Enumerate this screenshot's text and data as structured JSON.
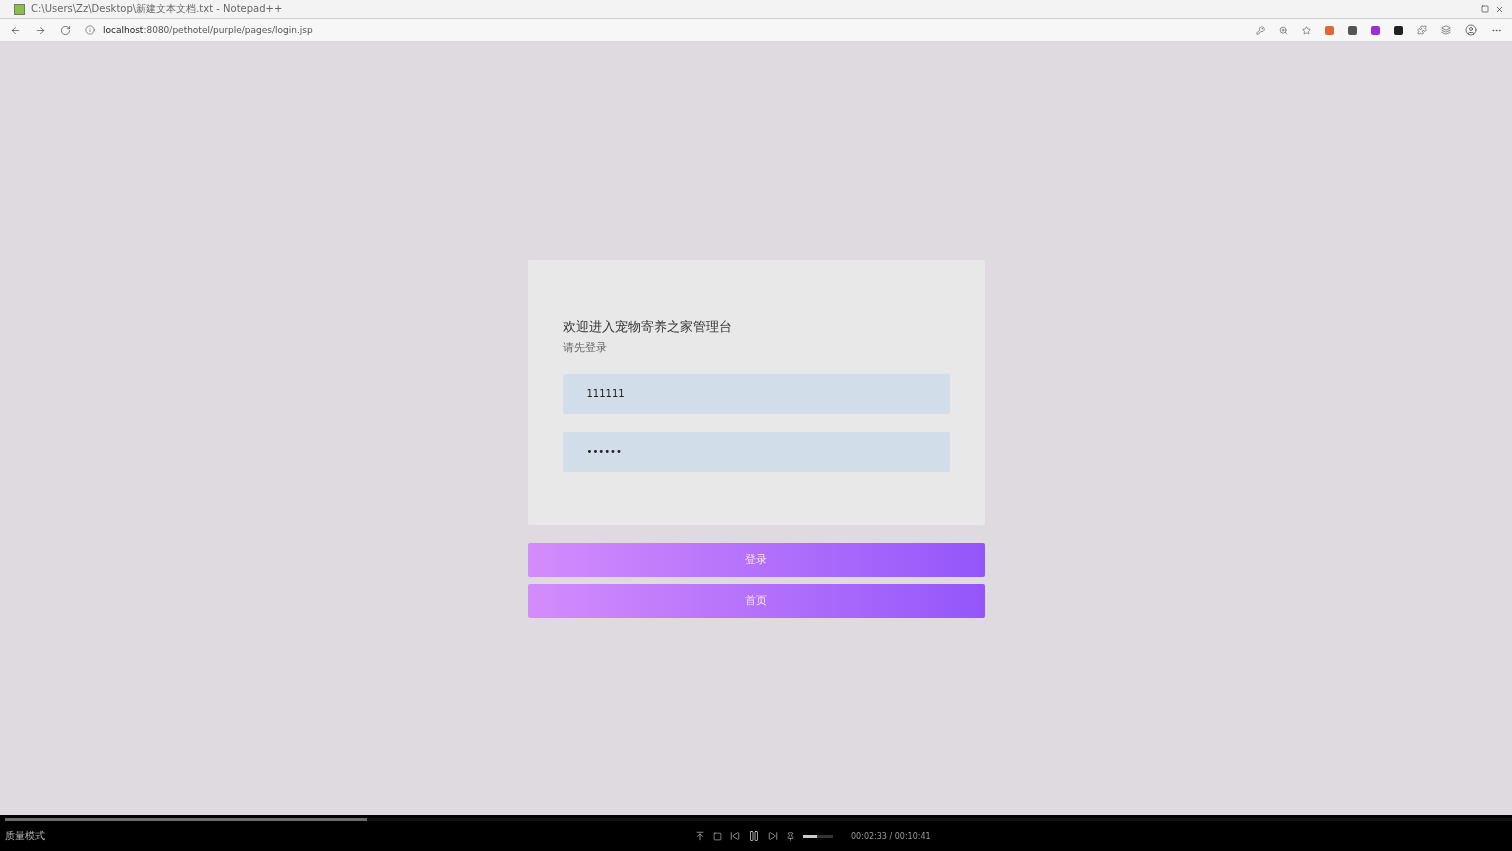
{
  "window": {
    "title": "C:\\Users\\Zz\\Desktop\\新建文本文档.txt - Notepad++"
  },
  "browser": {
    "url_host": "localhost",
    "url_rest": ":8080/pethotel/purple/pages/login.jsp"
  },
  "login": {
    "title": "欢迎进入宠物寄养之家管理台",
    "subtitle": "请先登录",
    "username": "111111",
    "password": "••••••",
    "buttons": [
      "登录",
      "首页"
    ]
  },
  "player": {
    "mode": "质量模式",
    "progress": {
      "level": 0.24
    },
    "volume": {
      "level": 0.45
    },
    "time": "00:02:33 / 00:10:41"
  }
}
